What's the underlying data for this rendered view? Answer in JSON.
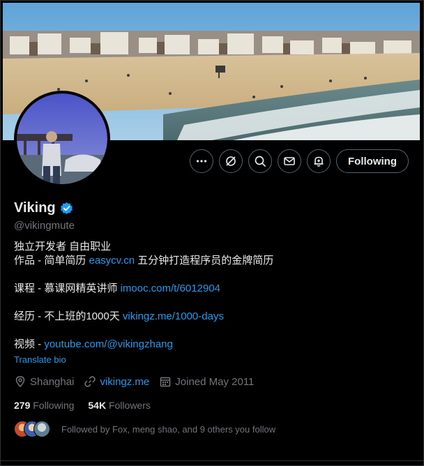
{
  "profile": {
    "display_name": "Viking",
    "handle": "@vikingmute",
    "verified": true
  },
  "actions": {
    "more_icon": "more-icon",
    "grok_icon": "grok-icon",
    "search_icon": "search-icon",
    "message_icon": "mail-icon",
    "notify_icon": "bell-icon",
    "following_label": "Following"
  },
  "bio": {
    "line1": "独立开发者 自由职业",
    "line2_prefix": "作品 - 简单简历 ",
    "line2_link": "easycv.cn",
    "line2_suffix": " 五分钟打造程序员的金牌简历",
    "line3_prefix": "课程 - 慕课网精英讲师 ",
    "line3_link": "imooc.com/t/6012904",
    "line4_prefix": "经历 - 不上班的1000天 ",
    "line4_link": "vikingz.me/1000-days",
    "line5_prefix": "视频 - ",
    "line5_link": "youtube.com/@vikingzhang",
    "translate": "Translate bio"
  },
  "meta": {
    "location": "Shanghai",
    "website": "vikingz.me",
    "joined": "Joined May 2011"
  },
  "stats": {
    "following_count": "279",
    "following_label": "Following",
    "followers_count": "54K",
    "followers_label": "Followers"
  },
  "followed_by": {
    "text": "Followed by Fox, meng shao, and 9 others you follow"
  },
  "colors": {
    "accent": "#1d9bf0",
    "muted": "#71767b",
    "background": "#000000"
  }
}
